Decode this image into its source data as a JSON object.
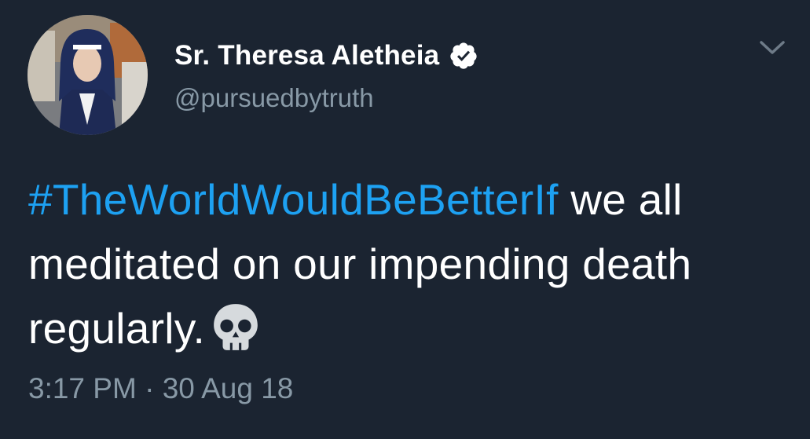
{
  "author": {
    "display_name": "Sr. Theresa Aletheia",
    "handle": "@pursuedbytruth",
    "verified": true,
    "avatar_icon": "profile-photo"
  },
  "tweet": {
    "hashtag": "#TheWorldWouldBeBetterIf",
    "text_after_hashtag": " we all meditated on our impending death regularly.",
    "emoji": "skull-icon"
  },
  "meta": {
    "time": "3:17 PM",
    "separator": "·",
    "date": "30 Aug 18"
  },
  "colors": {
    "background": "#1b2431",
    "hashtag": "#1da1f2",
    "secondary_text": "#8899a6",
    "primary_text": "#ffffff"
  }
}
